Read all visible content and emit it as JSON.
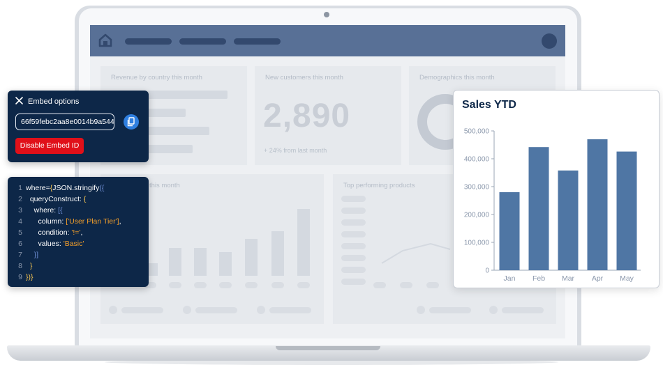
{
  "dashboard": {
    "cards": {
      "revenue_title": "Revenue by country this month",
      "customers_title": "New customers this month",
      "customers_value": "2,890",
      "customers_delta": "+ 24% from last month",
      "demographics_title": "Demographics this month",
      "sales_month_title": "this month",
      "top_products_title": "Top performing products"
    }
  },
  "embed": {
    "title": "Embed options",
    "embed_id": "66f59febc2aa8e0014b9a544",
    "disable_label": "Disable Embed ID",
    "close_icon": "close-icon",
    "copy_icon": "copy-icon"
  },
  "code": {
    "lines": [
      {
        "n": "1",
        "a": "where=",
        "b": "{",
        "c": "JSON.stringify",
        "d": "({",
        "e": ""
      },
      {
        "n": "2",
        "a": "  queryConstruct: ",
        "b": "{",
        "c": "",
        "d": "",
        "e": ""
      },
      {
        "n": "3",
        "a": "    where: ",
        "b": "[{",
        "c": "",
        "d": "",
        "e": ""
      },
      {
        "n": "4",
        "a": "      column: ",
        "b": "['User Plan Tier']",
        "c": ",",
        "d": "",
        "e": ""
      },
      {
        "n": "5",
        "a": "      condition: ",
        "b": "'!='",
        "c": ",",
        "d": "",
        "e": ""
      },
      {
        "n": "6",
        "a": "      values: ",
        "b": "'Basic'",
        "c": "",
        "d": "",
        "e": ""
      },
      {
        "n": "7",
        "a": "    ",
        "b": "}]",
        "c": "",
        "d": "",
        "e": ""
      },
      {
        "n": "8",
        "a": "  ",
        "b": "}",
        "c": "",
        "d": "",
        "e": ""
      },
      {
        "n": "9",
        "a": "",
        "b": "})}",
        "c": "",
        "d": "",
        "e": ""
      }
    ]
  },
  "colors": {
    "navy": "#0d2748",
    "bar": "#4f76a4",
    "danger": "#e01019",
    "accent_blue": "#2f7fe0",
    "appbar": "#587096"
  },
  "chart_data": {
    "type": "bar",
    "title": "Sales YTD",
    "categories": [
      "Jan",
      "Feb",
      "Mar",
      "Apr",
      "May"
    ],
    "values": [
      280000,
      442000,
      358000,
      470000,
      426000
    ],
    "ylim": [
      0,
      500000
    ],
    "yticks": [
      0,
      100000,
      200000,
      300000,
      400000,
      500000
    ],
    "ytick_labels": [
      "0",
      "100,000",
      "200,000",
      "300,000",
      "400,000",
      "500,000"
    ],
    "grid": false,
    "legend": "none"
  }
}
